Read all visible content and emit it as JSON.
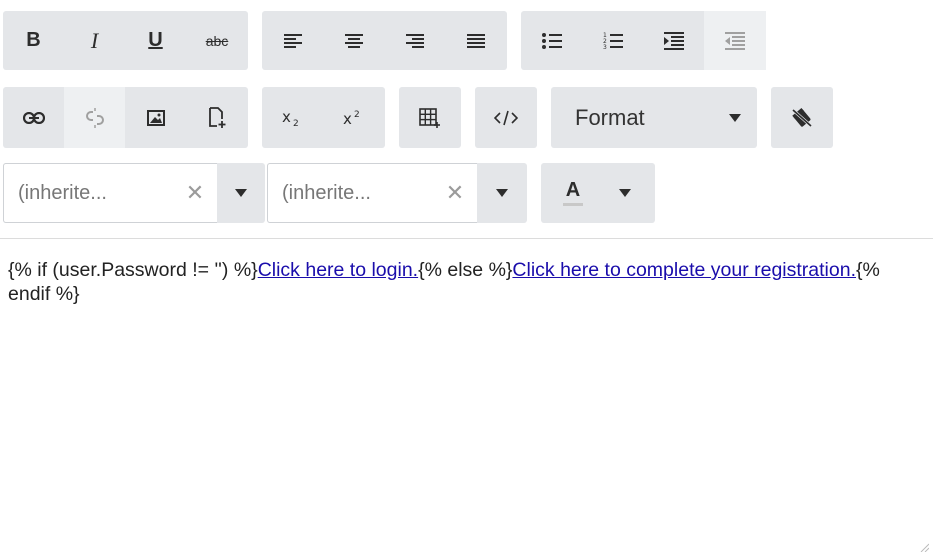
{
  "toolbar": {
    "row1": {
      "text_style": [
        {
          "label": "B",
          "icon": "bold-icon"
        },
        {
          "label": "I",
          "icon": "italic-icon"
        },
        {
          "label": "U",
          "icon": "underline-icon"
        },
        {
          "label": "abc",
          "icon": "strikethrough-icon"
        }
      ],
      "alignment": [
        "align-left-icon",
        "align-center-icon",
        "align-right-icon",
        "align-justify-icon"
      ],
      "lists": [
        "bullet-list-icon",
        "numbered-list-icon",
        "indent-icon",
        "outdent-icon"
      ]
    },
    "row2": {
      "insert": [
        "link-icon",
        "unlink-icon",
        "image-icon",
        "insert-file-icon"
      ],
      "script": [
        "subscript-icon",
        "superscript-icon"
      ],
      "format_label": "Format"
    },
    "row3": {
      "font_family": {
        "value": "(inherite...",
        "clear": "✕"
      },
      "font_size": {
        "value": "(inherite...",
        "clear": "✕"
      },
      "font_color_label": "A"
    }
  },
  "content": {
    "text1": "{% if (user.Password != '') %}",
    "link1": "Click here to login.",
    "text2": "{% else %}",
    "link2": "Click here to complete your registration.",
    "text3": "{% endif %}"
  }
}
